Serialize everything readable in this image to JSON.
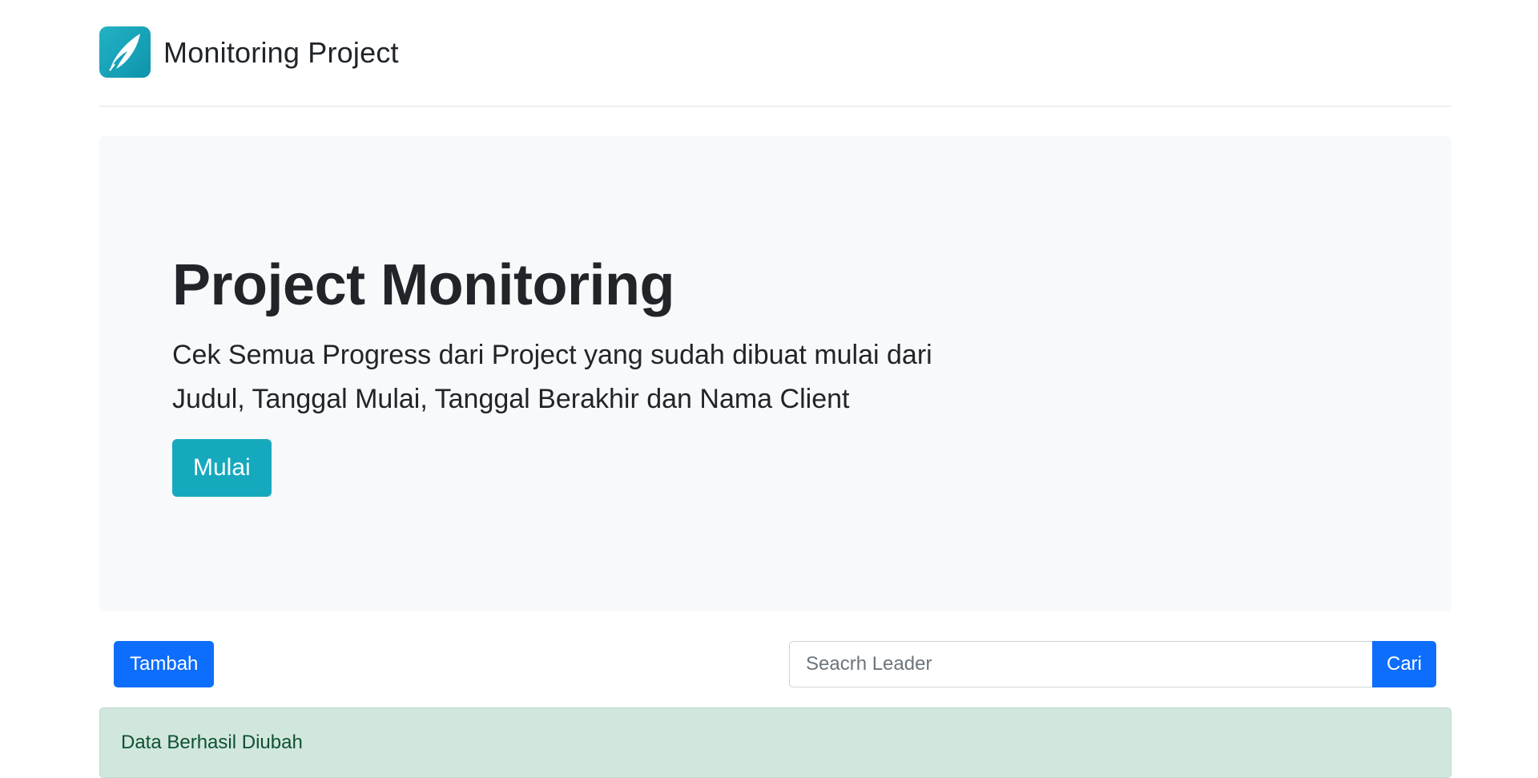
{
  "header": {
    "brand_title": "Monitoring Project",
    "logo_icon": "feather-logo-icon",
    "logo_color": "#1aa9bf"
  },
  "hero": {
    "title": "Project Monitoring",
    "description": "Cek Semua Progress dari Project yang sudah dibuat mulai dari Judul, Tanggal Mulai, Tanggal Berakhir dan Nama Client",
    "start_button_label": "Mulai",
    "button_color": "#16a9be"
  },
  "toolbar": {
    "add_button_label": "Tambah",
    "search_placeholder": "Seacrh Leader",
    "search_value": "",
    "search_button_label": "Cari",
    "primary_color": "#0d6efd"
  },
  "alert": {
    "message": "Data Berhasil Diubah",
    "type": "success"
  }
}
